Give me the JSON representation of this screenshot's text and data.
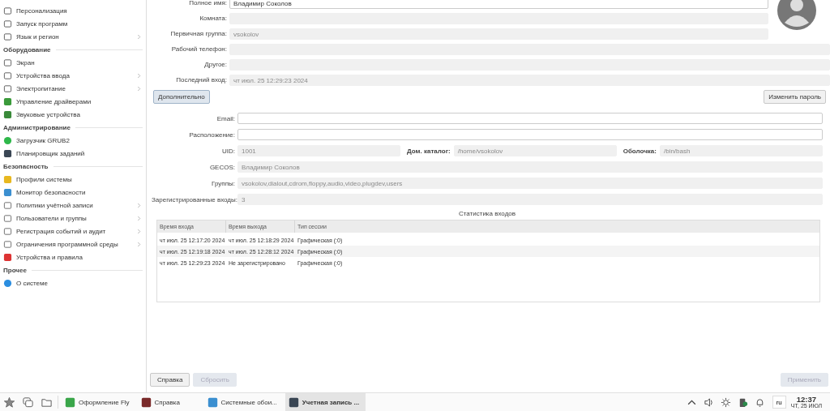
{
  "sidebar": {
    "sections": [
      {
        "items": [
          {
            "label": "Персонализация",
            "submenu": false
          },
          {
            "label": "Запуск программ",
            "submenu": false
          },
          {
            "label": "Язык и регион",
            "submenu": true
          }
        ]
      },
      {
        "title": "Оборудование",
        "items": [
          {
            "label": "Экран",
            "submenu": false
          },
          {
            "label": "Устройства ввода",
            "submenu": true
          },
          {
            "label": "Электропитание",
            "submenu": true
          },
          {
            "label": "Управление драйверами",
            "submenu": false
          },
          {
            "label": "Звуковые устройства",
            "submenu": false
          }
        ]
      },
      {
        "title": "Администрирование",
        "items": [
          {
            "label": "Загрузчик GRUB2",
            "submenu": false
          },
          {
            "label": "Планировщик заданий",
            "submenu": false
          }
        ]
      },
      {
        "title": "Безопасность",
        "items": [
          {
            "label": "Профили системы",
            "submenu": false
          },
          {
            "label": "Монитор безопасности",
            "submenu": false
          },
          {
            "label": "Политики учётной записи",
            "submenu": true
          },
          {
            "label": "Пользователи и группы",
            "submenu": true
          },
          {
            "label": "Регистрация событий и аудит",
            "submenu": true
          },
          {
            "label": "Ограничения программной среды",
            "submenu": true
          },
          {
            "label": "Устройства и правила",
            "submenu": false
          }
        ]
      },
      {
        "title": "Прочее",
        "items": [
          {
            "label": "О системе",
            "submenu": false
          }
        ]
      }
    ]
  },
  "account_fields": [
    {
      "label": "Полное имя:",
      "value": "Владимир Соколов",
      "disabled": false
    },
    {
      "label": "Комната:",
      "disabled": true
    },
    {
      "label": "Первичная группа:",
      "value": "vsokolov",
      "disabled": true
    },
    {
      "label": "Рабочий телефон:",
      "disabled": true
    },
    {
      "label": "Другое:",
      "disabled": true
    },
    {
      "label": "Последний вход:",
      "value": "чт июл. 25 12:29:23 2024",
      "disabled": true
    }
  ],
  "advanced_button": "Дополнительно",
  "change_password_button": "Изменить пароль",
  "advanced_rows": [
    {
      "fields": [
        {
          "label": "Email:",
          "disabled": false
        }
      ]
    },
    {
      "fields": [
        {
          "label": "Расположение:",
          "disabled": false
        }
      ]
    },
    {
      "fields": [
        {
          "label": "UID:",
          "value": "1001",
          "disabled": true
        },
        {
          "label": "Дом. каталог:",
          "value": "/home/vsokolov",
          "disabled": true
        },
        {
          "label": "Оболочка:",
          "value": "/bin/bash",
          "disabled": true
        }
      ]
    },
    {
      "fields": [
        {
          "label": "GECOS:",
          "value": "Владимир Соколов",
          "disabled": true
        }
      ]
    },
    {
      "fields": [
        {
          "label": "Группы:",
          "value": "vsokolov,dialout,cdrom,floppy,audio,video,plugdev,users",
          "disabled": true
        }
      ]
    },
    {
      "fields": [
        {
          "label": "Зарегистрированные входы:",
          "value": "3",
          "disabled": true
        }
      ]
    }
  ],
  "login_stats": {
    "title": "Статистика входов",
    "columns": [
      "Время входа",
      "Время выхода",
      "Тип сессии"
    ],
    "rows": [
      [
        "чт июл. 25 12:17:20 2024",
        "чт июл. 25 12:18:29 2024",
        "Графическая (:0)"
      ],
      [
        "чт июл. 25 12:19:18 2024",
        "чт июл. 25 12:28:12 2024",
        "Графическая (:0)"
      ],
      [
        "чт июл. 25 12:29:23 2024",
        "Не зарегистрировано",
        "Графическая (:0)"
      ]
    ]
  },
  "footer": {
    "left_buttons": [
      {
        "label": "Справка",
        "disabled": false
      },
      {
        "label": "Сбросить",
        "disabled": true
      }
    ],
    "apply": {
      "label": "Применить",
      "disabled": true
    }
  },
  "taskbar": {
    "tasks": [
      {
        "label": "Оформление Fly",
        "selected": false
      },
      {
        "label": "Справка",
        "selected": false
      },
      {
        "label": "Системные обои...",
        "selected": false
      },
      {
        "label": "Учетная запись ...",
        "selected": true
      }
    ],
    "keyboard_layout": "ru",
    "time": "12:37",
    "date": "ЧТ, 25 ИЮЛ"
  }
}
